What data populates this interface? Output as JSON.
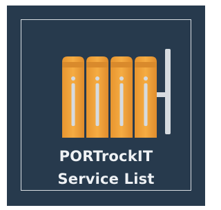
{
  "tile": {
    "title_line1": "PORTrockIT",
    "title_line2": "Service List",
    "icon": "server-rack-icon"
  },
  "colors": {
    "background": "#273a4d",
    "border": "#d9dee3",
    "text": "#eef1f4",
    "icon_orange": "#f3a43c",
    "icon_orange_dark": "#d98a2c",
    "icon_slot": "#d6dbe0"
  }
}
